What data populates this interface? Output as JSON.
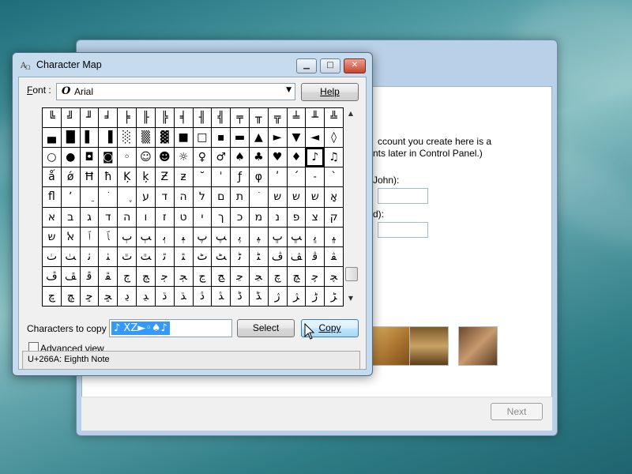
{
  "background_window": {
    "text_line1": "ccount you create here is a",
    "text_line2": "nts later in Control Panel.)",
    "label_name": "John):",
    "label_other": "d):",
    "next_label": "Next",
    "pictures": [
      "dog-picture",
      "chess-picture",
      "cat-picture"
    ]
  },
  "charmap": {
    "title": "Character Map",
    "font_label": "Font :",
    "font_value": "Arial",
    "help_label": "Help",
    "grid_rows": [
      [
        "╚",
        "╝",
        "╜",
        "╛",
        "╞",
        "╟",
        "╠",
        "╡",
        "╢",
        "╣",
        "╤",
        "╥",
        "╦",
        "╧",
        "╨",
        "╩"
      ],
      [
        "▄",
        "█",
        "▌",
        "▐",
        "░",
        "▒",
        "▓",
        "■",
        "□",
        "▪",
        "▬",
        "▲",
        "►",
        "▼",
        "◄",
        "◊"
      ],
      [
        "○",
        "●",
        "◘",
        "◙",
        "◦",
        "☺",
        "☻",
        "☼",
        "♀",
        "♂",
        "♠",
        "♣",
        "♥",
        "♦",
        "♪",
        "♫"
      ],
      [
        "ǻ",
        "ǿ",
        "Ħ",
        "ħ",
        "Ķ",
        "ķ",
        "Ƶ",
        "ƶ",
        "˘",
        "ˈ",
        "ƒ",
        "φ",
        "ʹ",
        "ˊ",
        "˗",
        "ˋ"
      ],
      [
        "ﬂ",
        "ʼ",
        "ֵ",
        "ֹ",
        "ֶ",
        "ע",
        "ד",
        "ה",
        "ל",
        "ם",
        "ת",
        "ֹ",
        "ש",
        "ש",
        "ש",
        "אָ"
      ],
      [
        "א",
        "ב",
        "ג",
        "ד",
        "ה",
        "ו",
        "ז",
        "ט",
        "י",
        "ך",
        "כ",
        "מ",
        "נ",
        "פ",
        "צ",
        "ק"
      ],
      [
        "ש",
        "ﭏ",
        "ﭐ",
        "ﭑ",
        "ﭒ",
        "ﭓ",
        "ﭔ",
        "ﭕ",
        "ﭖ",
        "ﭗ",
        "ﭘ",
        "ﭙ",
        "ﭚ",
        "ﭛ",
        "ﭜ",
        "ﭝ"
      ],
      [
        "ﭞ",
        "ﭟ",
        "ﭠ",
        "ﭡ",
        "ﭢ",
        "ﭣ",
        "ﭤ",
        "ﭥ",
        "ﭦ",
        "ﭧ",
        "ﭨ",
        "ﭩ",
        "ﭪ",
        "ﭫ",
        "ﭬ",
        "ﭭ"
      ],
      [
        "ﭮ",
        "ﭯ",
        "ﭰ",
        "ﭱ",
        "ﭲ",
        "ﭳ",
        "ﭴ",
        "ﭵ",
        "ﭶ",
        "ﭷ",
        "ﭸ",
        "ﭹ",
        "ﭺ",
        "ﭻ",
        "ﭼ",
        "ﭽ"
      ],
      [
        "ﭾ",
        "ﭿ",
        "ﮀ",
        "ﮁ",
        "ﮂ",
        "ﮃ",
        "ﮄ",
        "ﮅ",
        "ﮆ",
        "ﮇ",
        "ﮈ",
        "ﮉ",
        "ﮊ",
        "ﮋ",
        "ﮌ",
        "ﮍ"
      ]
    ],
    "selected_row": 2,
    "selected_col": 14,
    "characters_to_copy_label": "Characters to copy :",
    "characters_to_copy_value": "♪ XZ►◦♠♪",
    "select_label": "Select",
    "copy_label": "Copy",
    "advanced_view_label": "Advanced view",
    "advanced_view_checked": false,
    "status_text": "U+266A: Eighth Note"
  },
  "colors": {
    "title_bar": "#c6dbee",
    "selection": "#3399ff",
    "close_button": "#c8452f"
  }
}
